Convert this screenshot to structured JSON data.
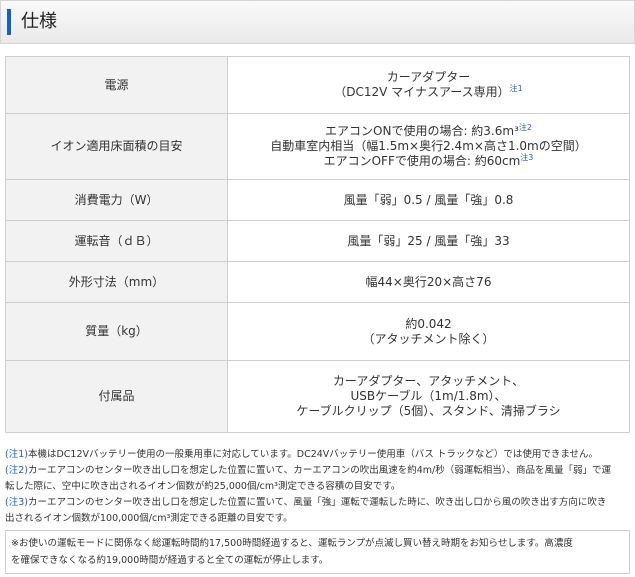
{
  "header": {
    "title": "仕様"
  },
  "spec": {
    "rows": [
      {
        "label": "電源",
        "lines": [
          "カーアダプター",
          "（DC12V マイナスアース専用）"
        ],
        "note": "注1"
      },
      {
        "label": "イオン適用床面積の目安",
        "lines": [
          "エアコンONで使用の場合: 約3.6m³",
          "自動車室内相当（幅1.5m×奥行2.4m×高さ1.0mの空間）",
          "エアコンOFFで使用の場合: 約60cm"
        ],
        "notes": [
          "注2",
          "",
          "注3"
        ]
      },
      {
        "label": "消費電力（W）",
        "lines": [
          "風量「弱」0.5 / 風量「強」0.8"
        ]
      },
      {
        "label": "運転音（ｄＢ）",
        "lines": [
          "風量「弱」25 / 風量「強」33"
        ]
      },
      {
        "label": "外形寸法（mm）",
        "lines": [
          "幅44×奥行20×高さ76"
        ]
      },
      {
        "label": "質量（kg）",
        "lines": [
          "約0.042",
          "（アタッチメント除く）"
        ]
      },
      {
        "label": "付属品",
        "lines": [
          "カーアダプター、アタッチメント、",
          "USBケーブル（1m/1.8m）、",
          "ケーブルクリップ（5個）、スタンド、清掃ブラシ"
        ]
      }
    ]
  },
  "notes": [
    {
      "id": "(注1)",
      "text": "本機はDC12Vバッテリー使用の一般乗用車に対応しています。DC24Vバッテリー使用車（バス トラックなど）では使用できません。"
    },
    {
      "id": "(注2)",
      "text": "カーエアコンのセンター吹き出し口を想定した位置に置いて、カーエアコンの吹出風速を約4m/秒（弱運転相当）、商品を風量「弱」で運"
    },
    {
      "id": "",
      "text": "転した際に、空中に吹き出されるイオン個数が約25,000個/cm³測定できる容積の目安です。"
    },
    {
      "id": "(注3)",
      "text": "カーエアコンのセンター吹き出し口を想定した位置に置いて、風量「強」運転で運転した時に、吹き出し口から風の吹き出す方向に吹き"
    },
    {
      "id": "",
      "text": "出されるイオン個数が100,000個/cm³測定できる距離の目安です。"
    }
  ],
  "footer": {
    "line1": "※お使いの運転モードに関係なく総運転時間約17,500時間経過すると、運転ランプが点滅し買い替え時期をお知らせします。高濃度",
    "line2": "を確保できなくなる約19,000時間が経過すると全ての運転が停止します。"
  }
}
